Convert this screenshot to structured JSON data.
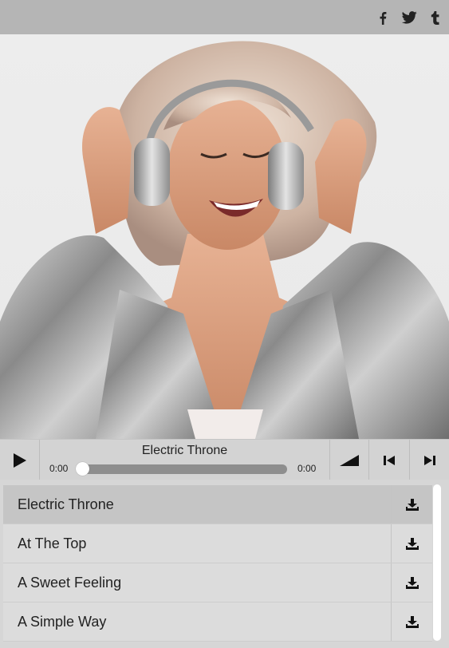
{
  "header": {
    "social_icons": [
      "facebook-icon",
      "twitter-icon",
      "tumblr-icon"
    ]
  },
  "cover": {
    "subject": "woman-with-headphones-photo"
  },
  "player": {
    "now_playing": "Electric Throne",
    "current_time": "0:00",
    "total_time": "0:00",
    "progress": 0,
    "icons": {
      "play": "play-icon",
      "volume": "volume-icon",
      "previous": "skip-previous-icon",
      "next": "skip-next-icon"
    }
  },
  "playlist": {
    "tracks": [
      {
        "title": "Electric Throne",
        "active": true
      },
      {
        "title": "At The Top",
        "active": false
      },
      {
        "title": "A Sweet Feeling",
        "active": false
      },
      {
        "title": "A Simple Way",
        "active": false
      }
    ],
    "download_icon": "download-icon"
  },
  "colors": {
    "topbar": "#b5b5b5",
    "controls": "#d3d3d3",
    "active_row": "#c5c5c5",
    "row": "#dcdcdc"
  }
}
